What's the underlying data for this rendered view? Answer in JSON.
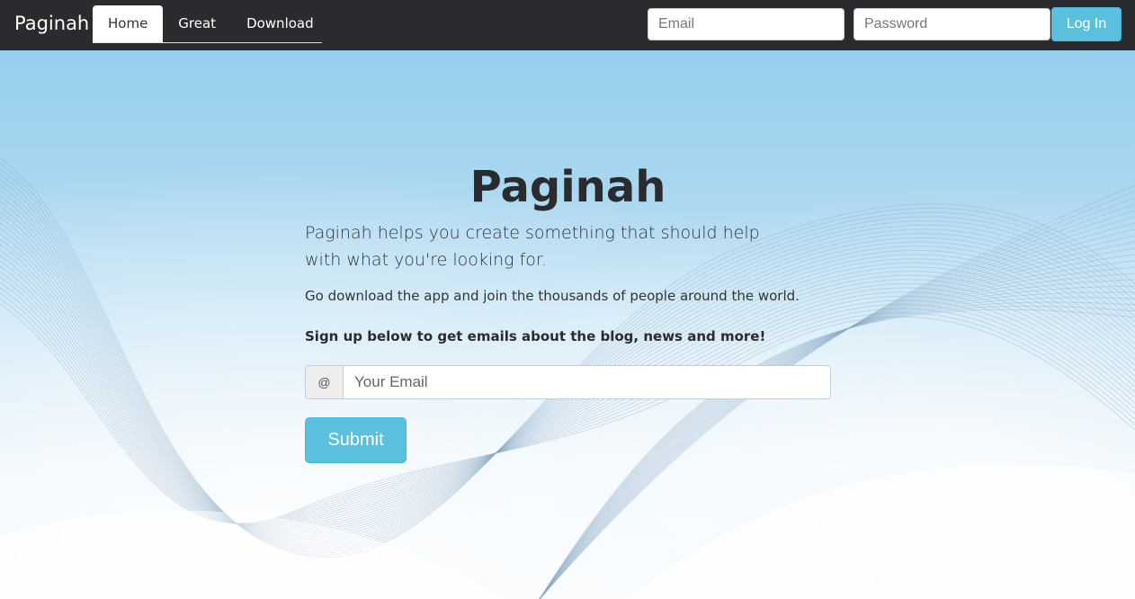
{
  "navbar": {
    "brand": "Paginah",
    "tabs": [
      {
        "label": "Home",
        "active": true
      },
      {
        "label": "Great",
        "active": false
      },
      {
        "label": "Download",
        "active": false
      }
    ],
    "login": {
      "email_placeholder": "Email",
      "password_placeholder": "Password",
      "button_label": "Log In"
    }
  },
  "hero": {
    "title": "Paginah",
    "lead": "Paginah helps you create something that should help with what you're looking for.",
    "sub": "Go download the app and join the thousands of people around the world.",
    "signup_text": "Sign up below to get emails about the blog, news and more!",
    "addon_symbol": "@",
    "email_placeholder": "Your Email",
    "submit_label": "Submit"
  },
  "colors": {
    "navbar_bg": "#2a2b2e",
    "accent": "#5bc0de",
    "background_top": "#8fcbec",
    "background_bottom": "#f4f9fd"
  }
}
